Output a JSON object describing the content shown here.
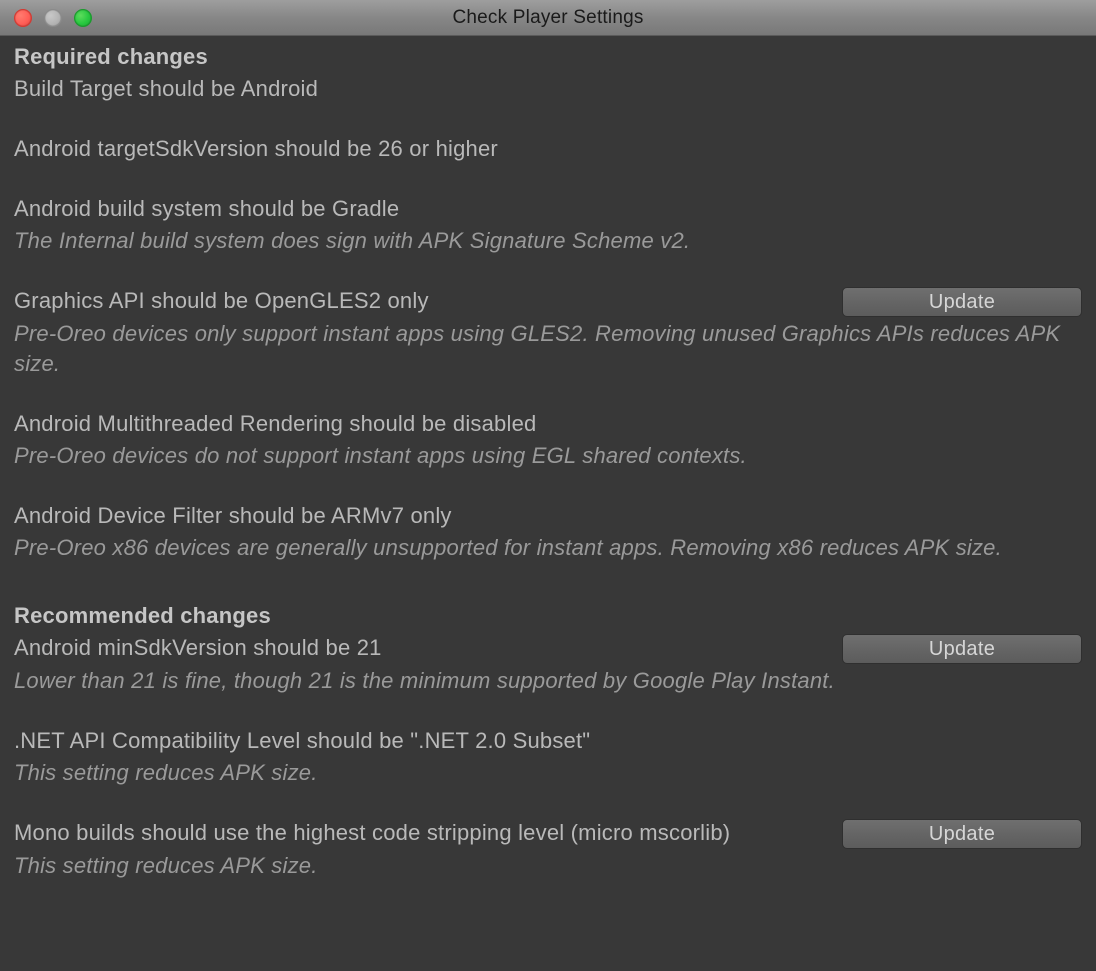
{
  "window": {
    "title": "Check Player Settings"
  },
  "sections": {
    "required": {
      "header": "Required changes",
      "items": [
        {
          "title": "Build Target should be Android",
          "desc": null,
          "button": null
        },
        {
          "title": "Android targetSdkVersion should be 26 or higher",
          "desc": null,
          "button": null
        },
        {
          "title": "Android build system should be Gradle",
          "desc": "The Internal build system does sign with APK Signature Scheme v2.",
          "button": null
        },
        {
          "title": "Graphics API should be OpenGLES2 only",
          "desc": "Pre-Oreo devices only support instant apps using GLES2. Removing unused Graphics APIs reduces APK size.",
          "button": "Update"
        },
        {
          "title": "Android Multithreaded Rendering should be disabled",
          "desc": "Pre-Oreo devices do not support instant apps using EGL shared contexts.",
          "button": null
        },
        {
          "title": "Android Device Filter should be ARMv7 only",
          "desc": "Pre-Oreo x86 devices are generally unsupported for instant apps. Removing x86 reduces APK size.",
          "button": null
        }
      ]
    },
    "recommended": {
      "header": "Recommended changes",
      "items": [
        {
          "title": "Android minSdkVersion should be 21",
          "desc": "Lower than 21 is fine, though 21 is the minimum supported by Google Play Instant.",
          "button": "Update"
        },
        {
          "title": ".NET API Compatibility Level should be \".NET 2.0 Subset\"",
          "desc": "This setting reduces APK size.",
          "button": null
        },
        {
          "title": "Mono builds should use the highest code stripping level (micro mscorlib)",
          "desc": "This setting reduces APK size.",
          "button": "Update"
        }
      ]
    }
  }
}
